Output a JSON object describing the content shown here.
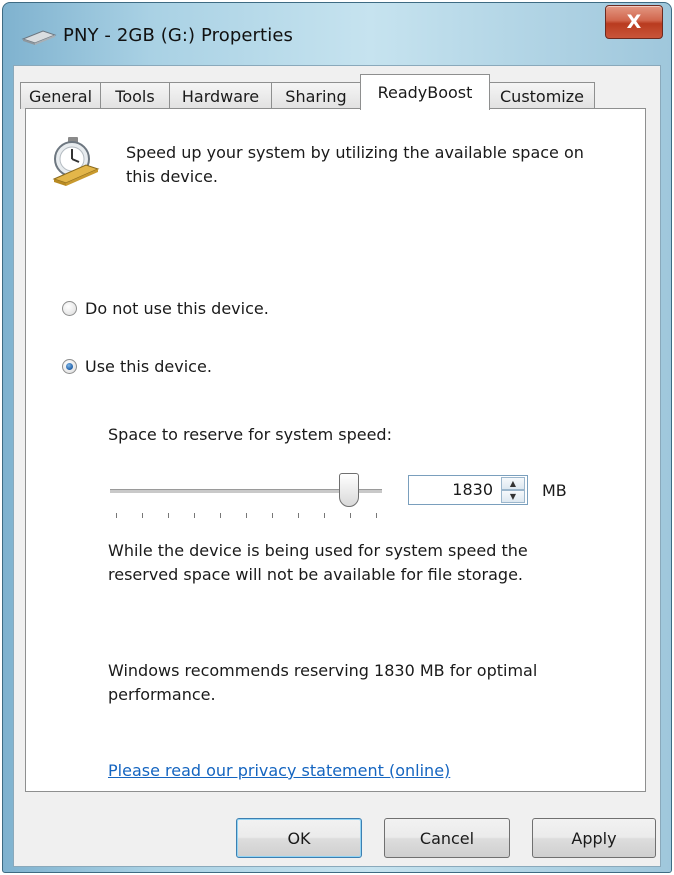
{
  "window": {
    "title": "PNY - 2GB (G:) Properties",
    "close_label": "X"
  },
  "tabs": [
    {
      "label": "General",
      "active": false
    },
    {
      "label": "Tools",
      "active": false
    },
    {
      "label": "Hardware",
      "active": false
    },
    {
      "label": "Sharing",
      "active": false
    },
    {
      "label": "ReadyBoost",
      "active": true
    },
    {
      "label": "Customize",
      "active": false
    }
  ],
  "readyboost": {
    "intro": "Speed up your system by utilizing the available space on this device.",
    "options": [
      {
        "label": "Do not use this device.",
        "selected": false
      },
      {
        "label": "Use this device.",
        "selected": true
      }
    ],
    "reserve_label": "Space to reserve for system speed:",
    "slider_level_fraction": 0.88,
    "reserve_value": "1830",
    "unit": "MB",
    "storage_note": "While the device is being used for system speed the reserved space will not be available for file storage.",
    "recommendation": "Windows recommends reserving 1830 MB for optimal performance.",
    "privacy_link": "Please read our privacy statement (online)"
  },
  "buttons": {
    "ok": "OK",
    "cancel": "Cancel",
    "apply": "Apply"
  },
  "colors": {
    "link": "#1565c0",
    "close_button": "#c9553a",
    "title_bar": "#a9d1e4"
  },
  "icons": {
    "title": "usb-drive-icon",
    "feature": "readyboost-stopwatch-icon"
  }
}
